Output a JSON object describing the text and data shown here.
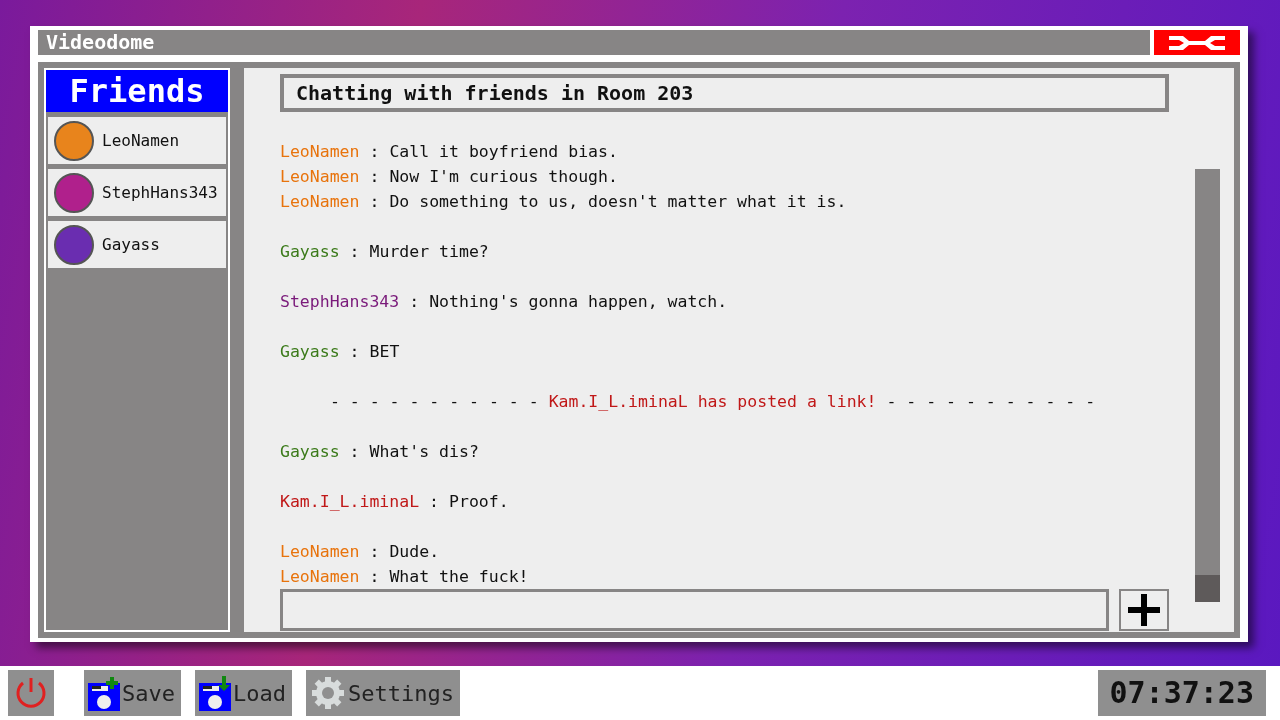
{
  "window": {
    "title": "Videodome"
  },
  "sidebar": {
    "title": "Friends",
    "friends": [
      {
        "name": "LeoNamen",
        "color": "#e8841c"
      },
      {
        "name": "StephHans343",
        "color": "#b0208c"
      },
      {
        "name": "Gayass",
        "color": "#6a2db0"
      }
    ]
  },
  "chat": {
    "title": "Chatting with friends in Room 203",
    "groups": [
      [
        {
          "kind": "message",
          "user": "LeoNamen",
          "color": "#e8730c",
          "separator": ":",
          "text": "Call it boyfriend bias."
        },
        {
          "kind": "message",
          "user": "LeoNamen",
          "color": "#e8730c",
          "separator": ":",
          "text": "Now I'm curious though."
        },
        {
          "kind": "message",
          "user": "LeoNamen",
          "color": "#e8730c",
          "separator": ":",
          "text": "Do something to us, doesn't matter what it is."
        }
      ],
      [
        {
          "kind": "message",
          "user": "Gayass",
          "color": "#3b7a1a",
          "separator": ":",
          "text": "Murder time?"
        }
      ],
      [
        {
          "kind": "message",
          "user": "StephHans343",
          "color": "#7a1a7a",
          "separator": ":",
          "text": "Nothing's gonna happen, watch."
        }
      ],
      [
        {
          "kind": "message",
          "user": "Gayass",
          "color": "#3b7a1a",
          "separator": ":",
          "text": "BET"
        }
      ],
      [
        {
          "kind": "notice",
          "dashes_left": "- - - - - - - - - - -",
          "text": "Kam.I_L.iminaL has posted a link!",
          "dashes_right": "- - - - - - - - - - -",
          "color": "#c01818"
        }
      ],
      [
        {
          "kind": "message",
          "user": "Gayass",
          "color": "#3b7a1a",
          "separator": ":",
          "text": "What's dis?"
        }
      ],
      [
        {
          "kind": "message",
          "user": "Kam.I_L.iminaL",
          "color": "#c01818",
          "separator": ":",
          "text": "Proof."
        }
      ],
      [
        {
          "kind": "message",
          "user": "LeoNamen",
          "color": "#e8730c",
          "separator": ":",
          "text": "Dude."
        },
        {
          "kind": "message",
          "user": "LeoNamen",
          "color": "#e8730c",
          "separator": ":",
          "text": "What the fuck!"
        }
      ]
    ]
  },
  "taskbar": {
    "buttons": [
      {
        "kind": "power"
      },
      {
        "kind": "save",
        "label": "Save"
      },
      {
        "kind": "load",
        "label": "Load"
      },
      {
        "kind": "settings",
        "label": "Settings"
      }
    ],
    "clock": "07:37:23"
  }
}
